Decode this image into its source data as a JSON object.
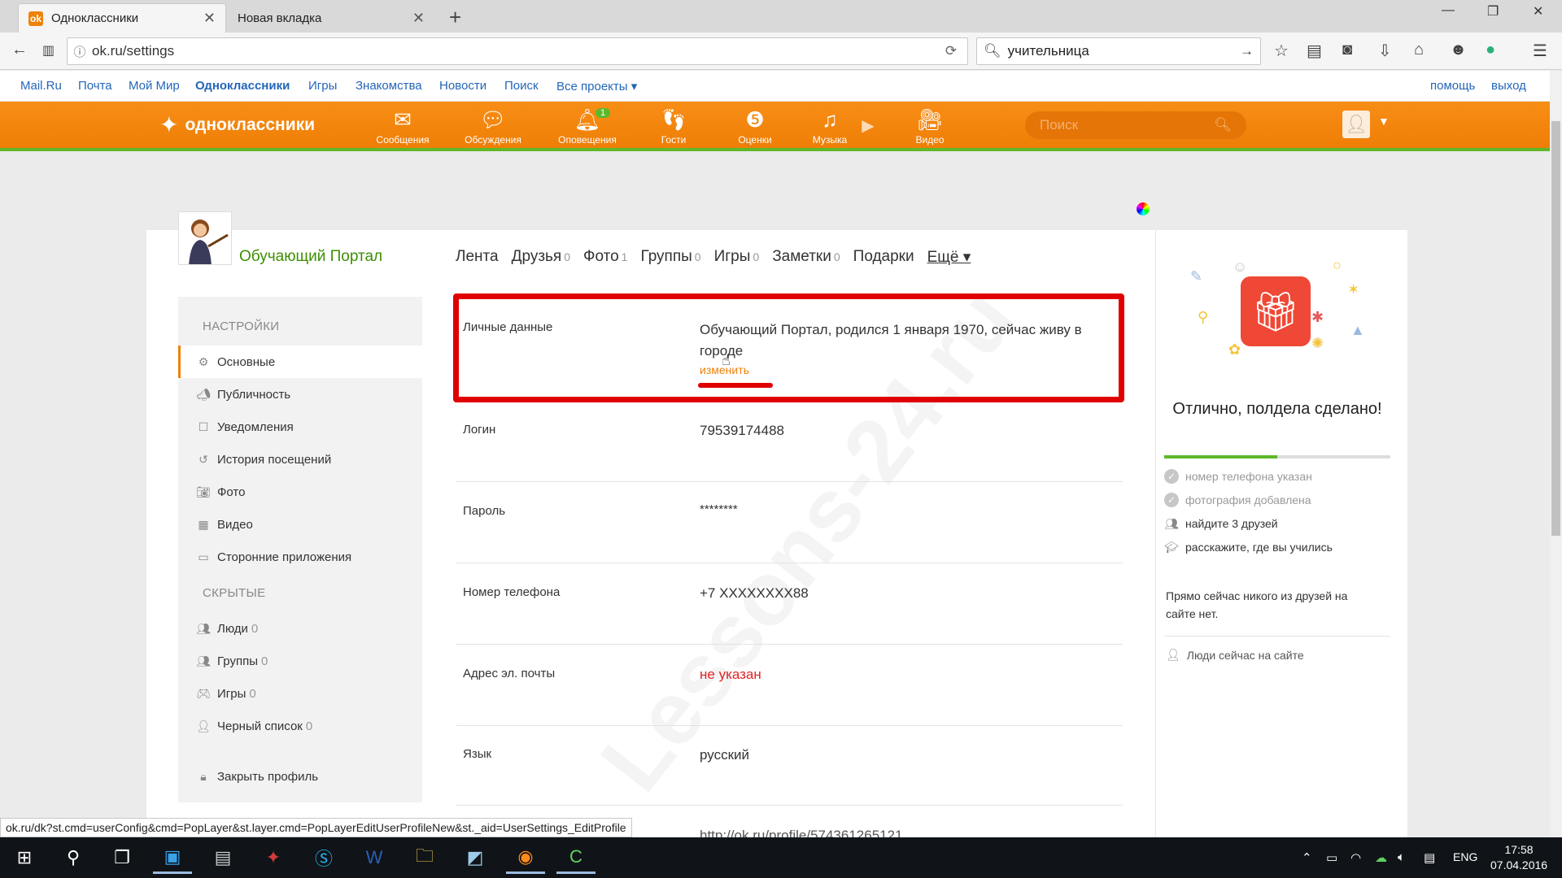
{
  "browser": {
    "tabs": [
      {
        "label": "Одноклассники",
        "active": true
      },
      {
        "label": "Новая вкладка",
        "active": false
      }
    ],
    "url": "ok.ru/settings",
    "search_query": "учительница",
    "status_url": "ok.ru/dk?st.cmd=userConfig&cmd=PopLayer&st.layer.cmd=PopLayerEditUserProfileNew&st._aid=UserSettings_EditProfile"
  },
  "mailbar": {
    "links": [
      "Mail.Ru",
      "Почта",
      "Мой Мир",
      "Одноклассники",
      "Игры",
      "Знакомства",
      "Новости",
      "Поиск",
      "Все проекты"
    ],
    "help": "помощь",
    "logout": "выход"
  },
  "okheader": {
    "logo": "одноклассники",
    "nav": [
      {
        "label": "Сообщения",
        "icon": "envelope-icon"
      },
      {
        "label": "Обсуждения",
        "icon": "chat-bubbles-icon"
      },
      {
        "label": "Оповещения",
        "icon": "bell-icon",
        "badge": "1"
      },
      {
        "label": "Гости",
        "icon": "footprints-icon"
      },
      {
        "label": "Оценки",
        "icon": "rating-icon"
      },
      {
        "label": "Музыка",
        "icon": "music-note-icon"
      },
      {
        "label": "Видео",
        "icon": "video-camera-icon"
      }
    ],
    "search_placeholder": "Поиск"
  },
  "profile": {
    "name": "Обучающий Портал",
    "tabs": [
      {
        "label": "Лента",
        "count": ""
      },
      {
        "label": "Друзья",
        "count": "0"
      },
      {
        "label": "Фото",
        "count": "1"
      },
      {
        "label": "Группы",
        "count": "0"
      },
      {
        "label": "Игры",
        "count": "0"
      },
      {
        "label": "Заметки",
        "count": "0"
      },
      {
        "label": "Подарки",
        "count": ""
      }
    ],
    "more": "Ещё ▾"
  },
  "sidebar": {
    "settings_header": "НАСТРОЙКИ",
    "settings_items": [
      {
        "label": "Основные",
        "icon": "gear-icon"
      },
      {
        "label": "Публичность",
        "icon": "megaphone-icon"
      },
      {
        "label": "Уведомления",
        "icon": "notification-icon"
      },
      {
        "label": "История посещений",
        "icon": "history-icon"
      },
      {
        "label": "Фото",
        "icon": "camera-icon"
      },
      {
        "label": "Видео",
        "icon": "film-icon"
      },
      {
        "label": "Сторонние приложения",
        "icon": "apps-icon"
      }
    ],
    "hidden_header": "СКРЫТЫЕ",
    "hidden_items": [
      {
        "label": "Люди",
        "count": "0",
        "icon": "people-icon"
      },
      {
        "label": "Группы",
        "count": "0",
        "icon": "groups-icon"
      },
      {
        "label": "Игры",
        "count": "0",
        "icon": "gamepad-icon"
      },
      {
        "label": "Черный список",
        "count": "0",
        "icon": "blacklist-icon"
      }
    ],
    "close_profile": "Закрыть профиль"
  },
  "settings": {
    "personal_label": "Личные данные",
    "personal_value": "Обучающий Портал, родился 1 января 1970, сейчас живу в городе",
    "edit_link": "изменить",
    "rows": [
      {
        "label": "Логин",
        "value": "79539174488"
      },
      {
        "label": "Пароль",
        "value": "********"
      },
      {
        "label": "Номер телефона",
        "value": "+7 XXXXXXXX88"
      },
      {
        "label": "Адрес эл. почты",
        "value": "не указан"
      },
      {
        "label": "Язык",
        "value": "русский"
      }
    ],
    "partial_url": "http://ok.ru/profile/574361265121"
  },
  "watermark": "Lessons-24.ru",
  "rightcard": {
    "title": "Отлично, полдела сделано!",
    "progress": 0.5,
    "checklist": [
      {
        "label": "номер телефона указан",
        "done": true
      },
      {
        "label": "фотография добавлена",
        "done": true
      },
      {
        "label": "найдите 3 друзей",
        "done": false
      },
      {
        "label": "расскажите, где вы учились",
        "done": false
      }
    ],
    "note": "Прямо сейчас никого из друзей на сайте нет.",
    "online": "Люди сейчас на сайте"
  },
  "taskbar": {
    "lang": "ENG",
    "time": "17:58",
    "date": "07.04.2016"
  },
  "colors": {
    "ok_orange": "#ee8208",
    "ok_green": "#5db829",
    "highlight_red": "#e00000",
    "link_blue": "#2466b8"
  }
}
